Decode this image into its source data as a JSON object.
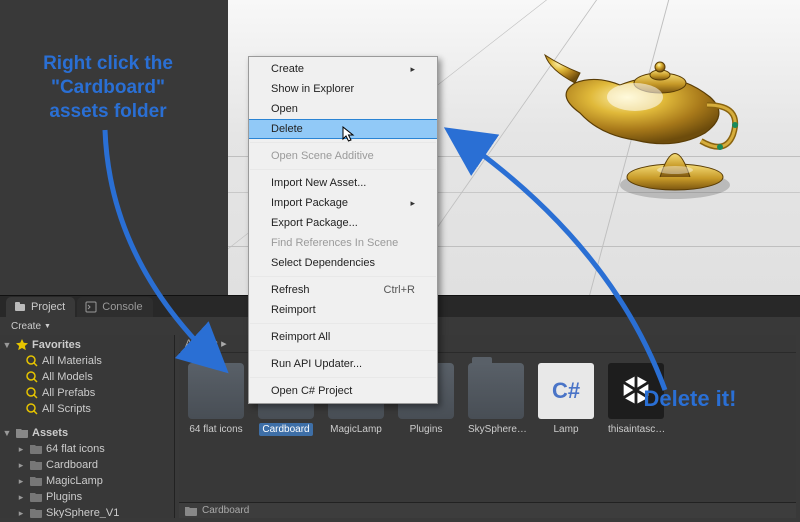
{
  "tabs": {
    "project": "Project",
    "console": "Console"
  },
  "toolbar": {
    "create": "Create"
  },
  "sidebar": {
    "favorites": "Favorites",
    "fav_items": [
      "All Materials",
      "All Models",
      "All Prefabs",
      "All Scripts"
    ],
    "assets": "Assets",
    "asset_folders": [
      "64 flat icons",
      "Cardboard",
      "MagicLamp",
      "Plugins",
      "SkySphere_V1"
    ]
  },
  "assets_area": {
    "header": "Assets ▸",
    "items": [
      {
        "label": "64 flat icons",
        "type": "folder",
        "selected": false
      },
      {
        "label": "Cardboard",
        "type": "folder",
        "selected": true
      },
      {
        "label": "MagicLamp",
        "type": "folder",
        "selected": false
      },
      {
        "label": "Plugins",
        "type": "folder",
        "selected": false
      },
      {
        "label": "SkySphere…",
        "type": "folder",
        "selected": false
      },
      {
        "label": "Lamp",
        "type": "csharp",
        "selected": false
      },
      {
        "label": "thisaintasc…",
        "type": "unity",
        "selected": false
      }
    ]
  },
  "breadcrumb": {
    "folder": "Cardboard"
  },
  "context_menu": {
    "create": "Create",
    "show_in_explorer": "Show in Explorer",
    "open": "Open",
    "delete": "Delete",
    "open_scene_additive": "Open Scene Additive",
    "import_new_asset": "Import New Asset...",
    "import_package": "Import Package",
    "export_package": "Export Package...",
    "find_references": "Find References In Scene",
    "select_dependencies": "Select Dependencies",
    "refresh": "Refresh",
    "refresh_shortcut": "Ctrl+R",
    "reimport": "Reimport",
    "reimport_all": "Reimport All",
    "run_api_updater": "Run API Updater...",
    "open_csharp_project": "Open C# Project"
  },
  "annotations": {
    "left": "Right click the\n\"Cardboard\"\nassets folder",
    "right": "Delete it!"
  }
}
